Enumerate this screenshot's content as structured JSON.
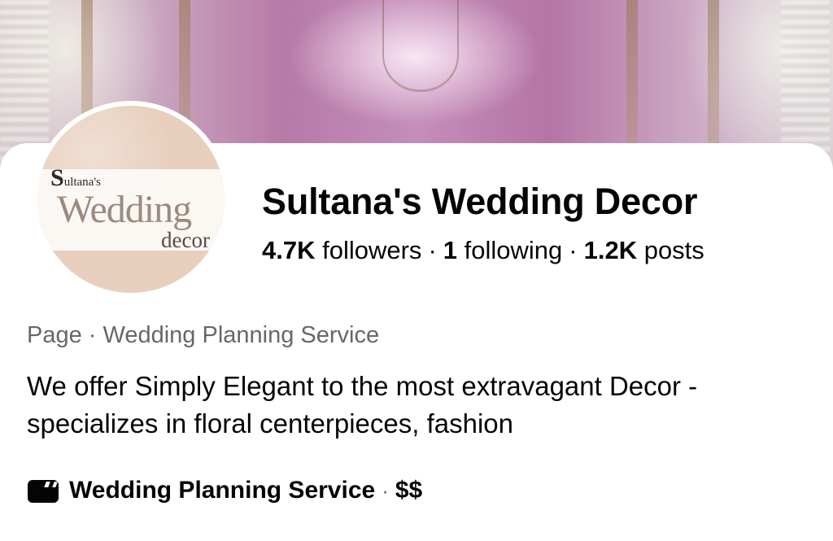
{
  "profile": {
    "name": "Sultana's Wedding Decor",
    "stats": {
      "followers_count": "4.7K",
      "followers_label": "followers",
      "following_count": "1",
      "following_label": "following",
      "posts_count": "1.2K",
      "posts_label": "posts",
      "separator": "·"
    },
    "category_line": "Page · Wedding Planning Service",
    "bio": "We offer Simply Elegant  to the most extravagant Decor - specializes in floral centerpieces, fashion",
    "info": {
      "icon": "video-clapper-icon",
      "category": "Wedding Planning Service",
      "separator": "·",
      "price_range": "$$"
    }
  },
  "avatar_logo": {
    "line1_initial": "S",
    "line1_rest": "ultana's",
    "line2": "Wedding",
    "line3": "decor"
  },
  "colors": {
    "text_primary": "#050505",
    "text_secondary": "#65676b",
    "avatar_background": "#e8cfbd"
  }
}
